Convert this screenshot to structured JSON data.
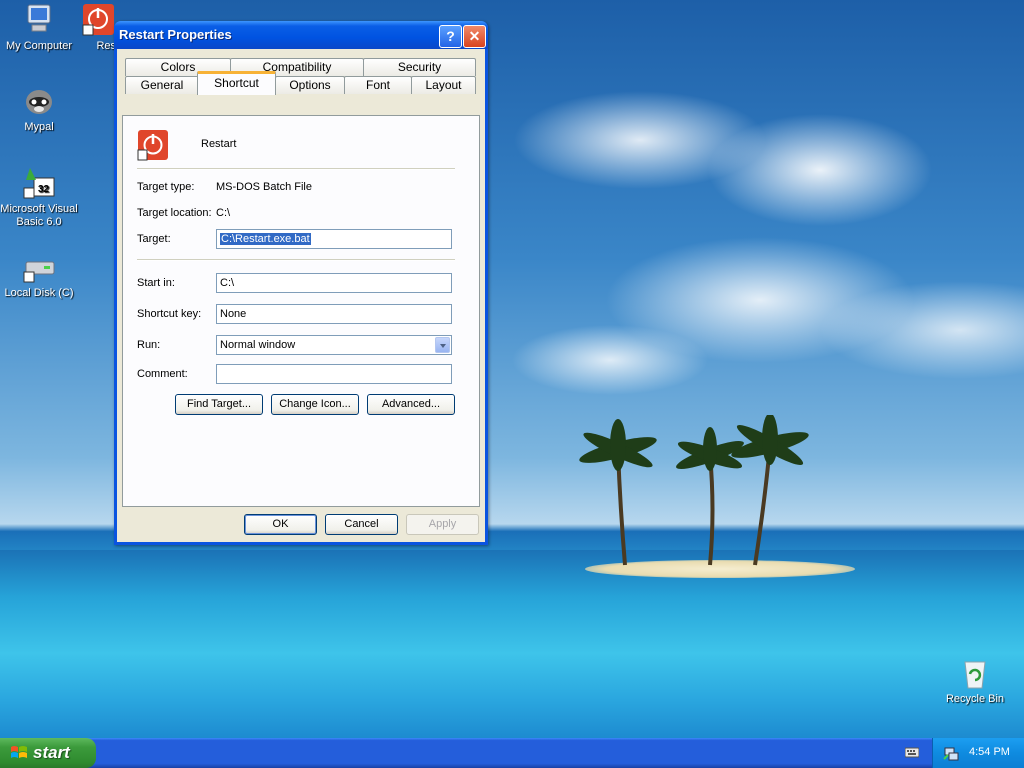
{
  "desktop": {
    "icons": [
      {
        "label": "My Computer"
      },
      {
        "label": "Res"
      },
      {
        "label": "Mypal"
      },
      {
        "label": "Microsoft Visual Basic 6.0"
      },
      {
        "label": "Local Disk (C)"
      },
      {
        "label": "Recycle Bin"
      }
    ]
  },
  "dialog": {
    "title": "Restart Properties",
    "help_btn": "?",
    "close_btn": "✕",
    "tabs_top": [
      "Colors",
      "Compatibility",
      "Security"
    ],
    "tabs_bottom": [
      "General",
      "Shortcut",
      "Options",
      "Font",
      "Layout"
    ],
    "active_tab": "Shortcut",
    "shortcut_name": "Restart",
    "target_type_label": "Target type:",
    "target_type_value": "MS-DOS Batch File",
    "target_location_label": "Target location:",
    "target_location_value": "C:\\",
    "target_label": "Target:",
    "target_value": "C:\\Restart.exe.bat",
    "start_in_label": "Start in:",
    "start_in_value": "C:\\",
    "shortcut_key_label": "Shortcut key:",
    "shortcut_key_value": "None",
    "run_label": "Run:",
    "run_value": "Normal window",
    "comment_label": "Comment:",
    "comment_value": "",
    "find_target_btn": "Find Target...",
    "change_icon_btn": "Change Icon...",
    "advanced_btn": "Advanced...",
    "ok_btn": "OK",
    "cancel_btn": "Cancel",
    "apply_btn": "Apply"
  },
  "taskbar": {
    "start_label": "start",
    "clock": "4:54 PM"
  },
  "colors": {
    "titlebar": "#0053e1",
    "start_green": "#3c9b3c",
    "taskbar_blue": "#245edb"
  }
}
